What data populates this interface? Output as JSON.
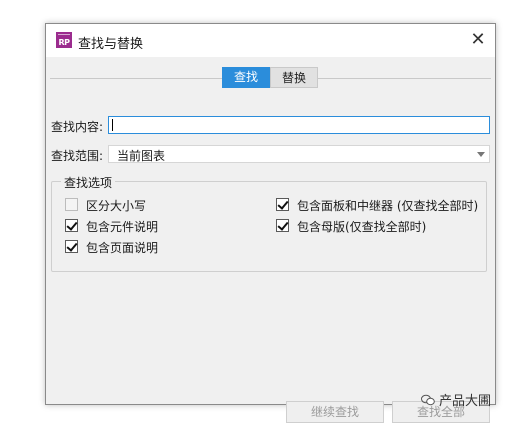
{
  "window": {
    "title": "查找与替换",
    "icon_label": "RP",
    "close_glyph": "✕"
  },
  "tabs": [
    {
      "label": "查找",
      "active": true
    },
    {
      "label": "替换",
      "active": false
    }
  ],
  "find": {
    "label": "查找内容:",
    "value": ""
  },
  "scope": {
    "label": "查找范围:",
    "selected": "当前图表"
  },
  "options": {
    "legend": "查找选项",
    "items": [
      {
        "label": "区分大小写",
        "checked": false
      },
      {
        "label": "包含元件说明",
        "checked": true
      },
      {
        "label": "包含页面说明",
        "checked": true
      },
      {
        "label": "包含面板和中继器 (仅查找全部时)",
        "checked": true
      },
      {
        "label": "包含母版(仅查找全部时)",
        "checked": true
      }
    ]
  },
  "buttons": {
    "continue": "继续查找",
    "find_all": "查找全部"
  },
  "watermark": {
    "text": "产品大圃"
  },
  "colors": {
    "accent": "#2b8ddb",
    "app_icon": "#9b2c8e"
  }
}
